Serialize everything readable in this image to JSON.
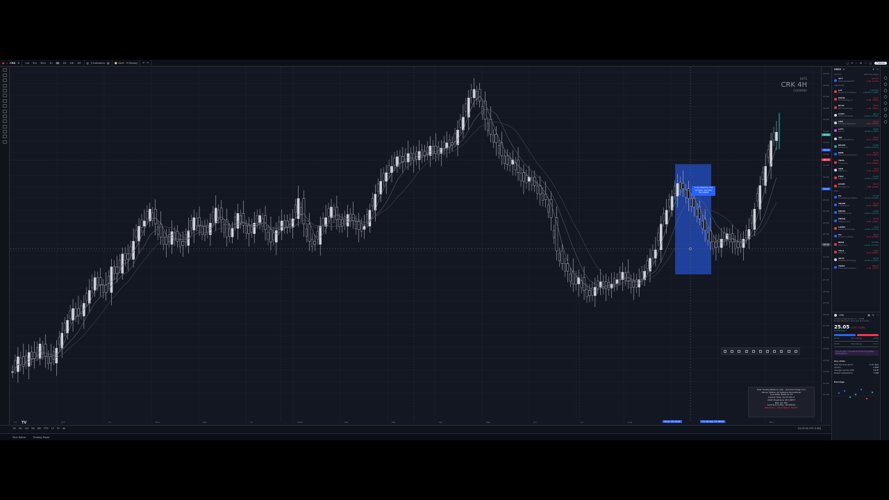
{
  "toolbar": {
    "symbol": "CRK",
    "timeframes": [
      "1m",
      "5m",
      "30m",
      "1h",
      "4h",
      "1D",
      "1W",
      "1M"
    ],
    "active_timeframe": "4h",
    "indicators_label": "Indicators",
    "alert_label": "Alert",
    "replay_label": "Replay",
    "publish_label": "Publish"
  },
  "chart": {
    "exchange": "BATS",
    "title": "CRK 4H",
    "company": "COMPANY",
    "selection_tooltip": [
      "5.79 (30.92%) 579",
      "27 bars, 16d 20h",
      "Vol 2.87M"
    ],
    "candles": [
      11,
      12.4,
      11.5,
      12.8,
      12.2,
      13.6,
      12.4,
      11.8,
      13.2,
      14.6,
      15.8,
      16.9,
      16.2,
      17.4,
      18.6,
      19.8,
      19.1,
      18.4,
      20.8,
      20.2,
      22,
      21.5,
      23.2,
      24.6,
      25.1,
      26.2,
      24.8,
      23.6,
      22.9,
      24.1,
      23.2,
      22.8,
      24.2,
      25.4,
      24.6,
      23.8,
      24.9,
      26.3,
      25.2,
      23.6,
      24.4,
      25.8,
      24.7,
      23.9,
      24.9,
      25.6,
      24.3,
      23.1,
      24.2,
      25.1,
      24.5,
      25.3,
      27.2,
      24.8,
      23.2,
      22.9,
      24.6,
      25.4,
      26.4,
      25.2,
      24.6,
      25.7,
      25.1,
      24.3,
      24.6,
      26.1,
      27.6,
      28.8,
      29.6,
      30.2,
      31.1,
      30.6,
      31.4,
      30.8,
      31.6,
      31.2,
      32.1,
      31.4,
      31.9,
      32.4,
      32.2,
      33.6,
      34.8,
      36.6,
      37.4,
      36.3,
      34.6,
      33.2,
      32.4,
      31.2,
      30.4,
      30.8,
      29.6,
      28.8,
      29.2,
      28.4,
      27.6,
      27.1,
      25.4,
      22.3,
      21.1,
      20.4,
      19.2,
      19.8,
      18.6,
      18.1,
      18.9,
      19.4,
      18.8,
      19.2,
      19.6,
      20.3,
      19.5,
      18.9,
      19.6,
      20.4,
      21.6,
      22.4,
      24.8,
      26.1,
      27.4,
      28.6,
      28.1,
      27.2,
      26.4,
      25.3,
      24.2,
      23.1,
      22.6,
      23.4,
      23.9,
      23.1,
      22.6,
      23.4,
      24.3,
      26.2,
      28.4,
      30.2,
      32.6,
      33.4
    ]
  },
  "price_axis": {
    "labels": [
      "39.00",
      "38.00",
      "37.00",
      "36.00",
      "35.00",
      "34.00",
      "33.00",
      "32.00",
      "31.00",
      "30.00",
      "29.00",
      "28.00",
      "27.00",
      "26.00",
      "25.00",
      "24.00",
      "23.00",
      "22.00",
      "21.00",
      "20.00",
      "19.00",
      "18.00",
      "17.00",
      "16.00",
      "15.00",
      "14.00",
      "13.00",
      "12.00",
      "11.00"
    ],
    "tags": [
      {
        "text": "30.84",
        "color": "#26a69a"
      },
      {
        "text": "29.18",
        "color": "#2962ff"
      },
      {
        "text": "26.10",
        "color": "#f23645"
      },
      {
        "text": "24.41",
        "color": "#2962ff"
      },
      {
        "text": "22.31",
        "color": "#434651"
      }
    ]
  },
  "time_axis": [
    "14",
    "Oct",
    "13",
    "Nov",
    "Dec",
    "13",
    "2025",
    "Feb",
    "Mar",
    "Apr",
    "May",
    "Jun",
    "Jul",
    "Aug",
    "Sep",
    "Oct",
    "Nov"
  ],
  "time_axis_selection": [
    "18 Jul '25  16:00",
    "Thu 04 Sep '25  08:00"
  ],
  "bottom_bar": {
    "ranges": [
      "1D",
      "5D",
      "1M",
      "3M",
      "6M",
      "YTD",
      "1Y",
      "5Y",
      "All"
    ],
    "clock": "15:23:34 UTC-5  ADJ"
  },
  "panels": [
    "Pine Editor",
    "Trading Panel"
  ],
  "overlay": {
    "lines": [
      "Elite Trading Network (V6) - Quantum Edge v3.2",
      "Server Status: All Systems Operational",
      "Live Date: 2025-11-13",
      "Current Time: 15:23 UTC-5",
      "2025 Timeframe 4H  0.5877",
      "Max Lev 30x",
      "Contracts to Buy: 10,000.61"
    ],
    "warning": "PRO Entry - Trend Status: FAILED"
  },
  "watchlist": {
    "title": "XBOX",
    "col_symbol": "Symbol",
    "col_last": "Last  Chg  Chg%",
    "section_main": "WATCHLIST",
    "section_etf": "ETFs",
    "rows": [
      {
        "sym": "SPY",
        "desc": "SPDR S&P 500 ETF",
        "last": "673.97",
        "chg": "-1.82 -0.27%",
        "dir": "dn",
        "color": "#2962ff"
      },
      {
        "sym": "LLY",
        "desc": "Eli Lilly and Company",
        "last": "1,012.81",
        "chg": "+14.56 +1.46%",
        "dir": "up",
        "color": "#f23645"
      },
      {
        "sym": "MSTR",
        "desc": "MicroStrategy Inc",
        "last": "17.57",
        "chg": "-0.56 -3.09%",
        "dir": "dn",
        "color": "#f23645"
      },
      {
        "sym": "RCAT",
        "desc": "Red Cat Holdings",
        "last": "20.13",
        "chg": "-1.25 -5.85%",
        "dir": "dn",
        "color": "#f23645"
      },
      {
        "sym": "COST",
        "desc": "Costco Wholesale",
        "last": "36.71",
        "chg": "+0.21 +0.58%",
        "dir": "up",
        "color": "#d1d4dc"
      },
      {
        "sym": "CRK",
        "desc": "Comstock Resources",
        "last": "25.05",
        "chg": "-0.07 -0.28%",
        "dir": "dn",
        "color": "#d1d4dc",
        "sel": true
      },
      {
        "sym": "LYFT",
        "desc": "Lyft, Inc.",
        "last": "24.90",
        "chg": "+0.38 +1.55%",
        "dir": "up",
        "color": "#e040fb"
      },
      {
        "sym": "TJX",
        "desc": "TJX Companies Inc",
        "last": "16.52",
        "chg": "-0.21 -1.25%",
        "dir": "dn",
        "color": "#d1d4dc"
      },
      {
        "sym": "RRAM",
        "desc": "Rambus Inc",
        "last": "17.81",
        "chg": "+0.09 +0.51%",
        "dir": "up",
        "color": "#26a69a"
      },
      {
        "sym": "NEM",
        "desc": "Newmont Corporation",
        "last": "85.24",
        "chg": "-0.73 -0.85%",
        "dir": "dn",
        "color": "#2962ff"
      },
      {
        "sym": "TNTA",
        "desc": "Trinseo PLC",
        "last": "36.80",
        "chg": "-0.31 -0.84%",
        "dir": "dn",
        "color": "#f23645"
      },
      {
        "sym": "OKE",
        "desc": "ONEOK Inc",
        "last": "8.21",
        "chg": "-0.05 -0.61%",
        "dir": "dn",
        "color": "#d1d4dc"
      },
      {
        "sym": "FSLY",
        "desc": "Fastly Inc",
        "last": "11.87",
        "chg": "+0.25 +2.15%",
        "dir": "up",
        "color": "#f23645"
      },
      {
        "sym": "DASH",
        "desc": "DoorDash Inc",
        "last": "16.13",
        "chg": "-0.08 -0.49%",
        "dir": "dn",
        "color": "#f23645"
      },
      {
        "sym": "HL",
        "desc": "Hecla Mining Company",
        "last": "15.18",
        "chg": "+0.14 +0.93%",
        "dir": "up",
        "color": "#2962ff"
      },
      {
        "sym": "TROW",
        "desc": "T. Rowe Price",
        "last": "16.13",
        "chg": "-0.14 -0.86%",
        "dir": "dn",
        "color": "#2962ff"
      },
      {
        "sym": "MDUS",
        "desc": "MDU Resources",
        "last": "14.88",
        "chg": "+0.07 +0.47%",
        "dir": "up",
        "color": "#2962ff"
      },
      {
        "sym": "MDXG",
        "desc": "MiMedx Group",
        "last": "10.56",
        "chg": "-0.22 -2.04%",
        "dir": "dn",
        "color": "#2962ff"
      },
      {
        "sym": "LUMN",
        "desc": "Lumen Technologies",
        "last": "8.10",
        "chg": "+0.06 +0.75%",
        "dir": "up",
        "color": "#f23645"
      },
      {
        "sym": "PG",
        "desc": "Procter & Gamble",
        "last": "43.01",
        "chg": "-0.17 -0.39%",
        "dir": "dn",
        "color": "#2962ff"
      },
      {
        "sym": "BIRD",
        "desc": "Allbirds Inc",
        "last": "573.85",
        "chg": "+4.12 +0.72%",
        "dir": "up",
        "color": "#f23645"
      },
      {
        "sym": "TSLA",
        "desc": "Tesla, Inc.",
        "last": "12.81",
        "chg": "-0.11 -0.85%",
        "dir": "dn",
        "color": "#f23645"
      },
      {
        "sym": "SKYT",
        "desc": "SkyWater Technology",
        "last": "90.18",
        "chg": "+1.45 +1.63%",
        "dir": "up",
        "color": "#d1d4dc"
      },
      {
        "sym": "TSEM",
        "desc": "Tower Semiconductor",
        "last": "106.53",
        "chg": "-2.10 -1.93%",
        "dir": "dn",
        "color": "#2962ff"
      }
    ]
  },
  "detail": {
    "symbol": "CRK",
    "company": "Comstock Resources, Inc.  •  NYSE",
    "sector": "Energy Minerals  •  Oil & Gas Production",
    "price": "25.05",
    "change": "-0.07  -0.28%",
    "market": "Market open",
    "range_low": "24.43",
    "range_label": "Day's Range",
    "range_high": "25.88",
    "w52_low": "15.00",
    "w52_label": "52wk Range",
    "w52_high": "31.17",
    "earnings_pill": "2 hours ago  •  Comstock Q3 Earnings Beat Estimates on...",
    "key_stats_title": "Key stats",
    "stats": [
      {
        "k": "Next earnings report",
        "v": "in 97 days"
      },
      {
        "k": "Volume",
        "v": "1.08M"
      },
      {
        "k": "Average volume (30D)",
        "v": "3.81M"
      },
      {
        "k": "Market capitalization",
        "v": "7.34B"
      }
    ],
    "earnings_title": "Earnings"
  }
}
